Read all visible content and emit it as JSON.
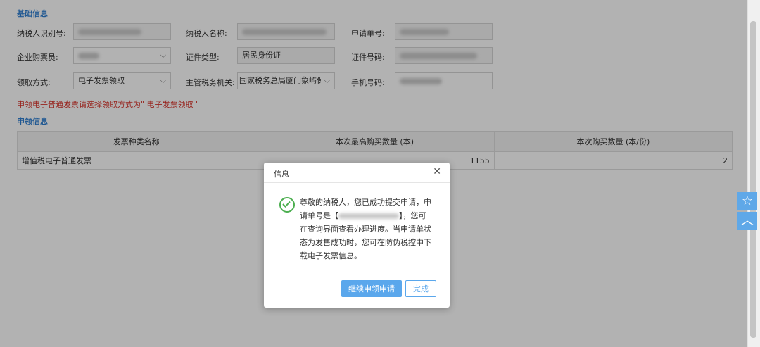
{
  "basic_info": {
    "title": "基础信息",
    "taxpayer_id_label": "纳税人识别号:",
    "taxpayer_name_label": "纳税人名称:",
    "application_no_label": "申请单号:",
    "buyer_label": "企业购票员:",
    "id_type_label": "证件类型:",
    "id_type_value": "居民身份证",
    "id_number_label": "证件号码:",
    "pickup_method_label": "领取方式:",
    "pickup_method_value": "电子发票领取",
    "tax_authority_label": "主管税务机关:",
    "tax_authority_value": "国家税务总局厦门象屿保税",
    "phone_label": "手机号码:"
  },
  "warning_text": "申领电子普通发票请选择领取方式为\" 电子发票领取 \"",
  "apply_info": {
    "title": "申领信息",
    "columns": [
      "发票种类名称",
      "本次最高购买数量 (本)",
      "本次购买数量 (本/份)"
    ],
    "rows": [
      {
        "name": "增值税电子普通发票",
        "max_qty": "1155",
        "qty": "2"
      }
    ]
  },
  "dialog": {
    "title": "信息",
    "message_part1": "尊敬的纳税人，您已成功提交申请，申请单号是【",
    "message_part2": "】，您可在查询界面查看办理进度。当申请单状态为发售成功时，您可在防伪税控中下载电子发票信息。",
    "continue_button": "继续申领申请",
    "done_button": "完成"
  },
  "icons": {
    "chevron": "chevron-down-icon",
    "close": "close-icon",
    "success": "check-circle-icon",
    "star": "star-icon",
    "top": "chevron-up-icon"
  }
}
